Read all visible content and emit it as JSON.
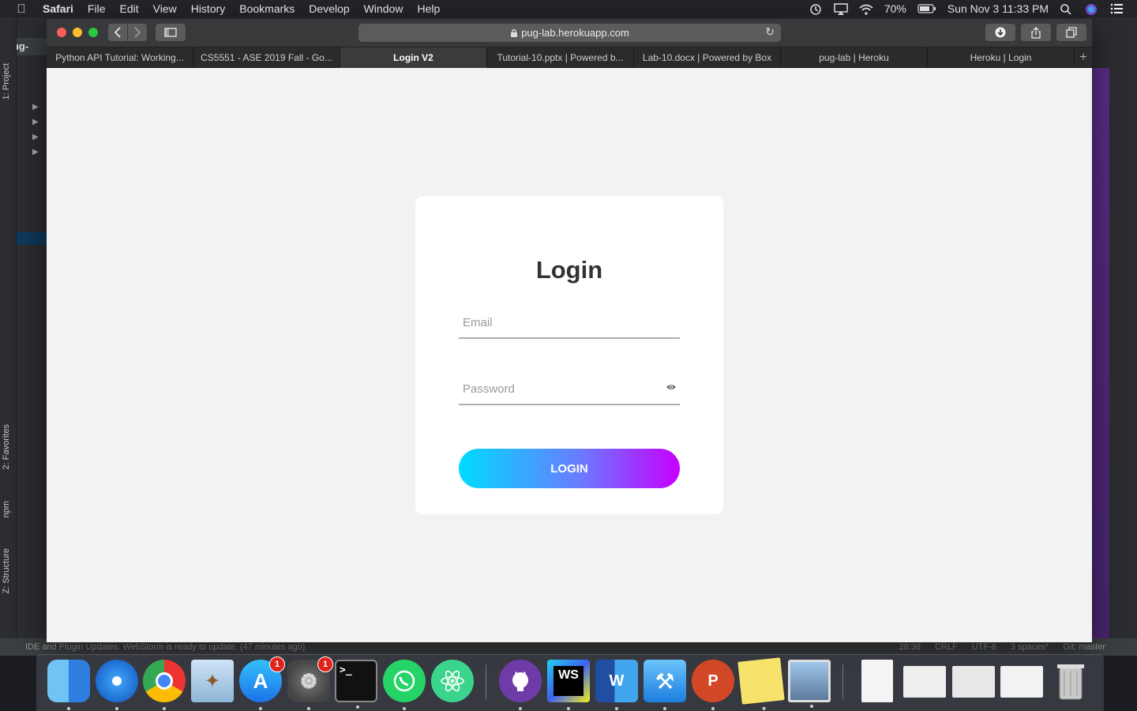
{
  "menubar": {
    "app_name": "Safari",
    "items": [
      "File",
      "Edit",
      "View",
      "History",
      "Bookmarks",
      "Develop",
      "Window",
      "Help"
    ],
    "battery": "70%",
    "datetime": "Sun Nov 3  11:33 PM"
  },
  "ide": {
    "project_title": "pug-",
    "vtabs": {
      "project": "1: Project",
      "favorites": "2: Favorites",
      "npm": "npm",
      "structure": "Z: Structure"
    },
    "status_message": "IDE and Plugin Updates: WebStorm is ready to update. (47 minutes ago)",
    "status_right": [
      "28:38",
      "CRLF",
      "UTF-8",
      "3 spaces*",
      "Git: master"
    ]
  },
  "safari": {
    "url": "pug-lab.herokuapp.com",
    "tabs": [
      {
        "label": "Python API Tutorial: Working..."
      },
      {
        "label": "CS5551 - ASE 2019 Fall - Go..."
      },
      {
        "label": "Login V2"
      },
      {
        "label": "Tutorial-10.pptx | Powered b..."
      },
      {
        "label": "Lab-10.docx | Powered by Box"
      },
      {
        "label": "pug-lab | Heroku"
      },
      {
        "label": "Heroku | Login"
      }
    ],
    "new_tab_label": "+"
  },
  "login": {
    "title": "Login",
    "email_placeholder": "Email",
    "password_placeholder": "Password",
    "button_label": "LOGIN"
  },
  "colors": {
    "gradient_start": "#00dbff",
    "gradient_end": "#c600ff",
    "page_bg": "#f2f2f2"
  },
  "dock": {
    "badges": {
      "app_store": "1",
      "system_preferences": "1"
    },
    "terminal_prompt": ">_",
    "webstorm_label": "WS",
    "word_label": "W",
    "powerpoint_label": "P"
  }
}
